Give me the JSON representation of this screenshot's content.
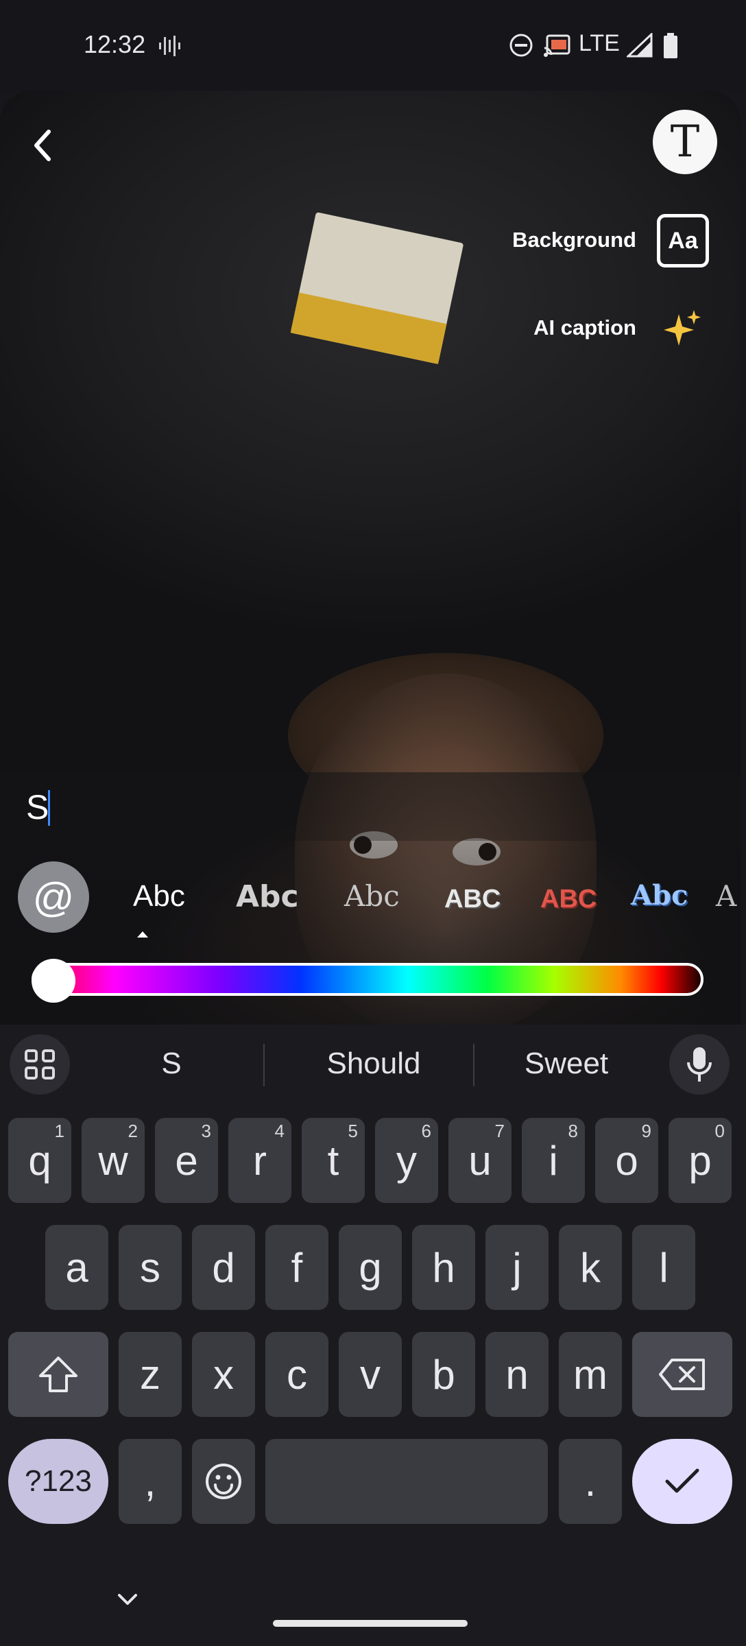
{
  "status_bar": {
    "time": "12:32",
    "icons": [
      "voice-waveform-icon",
      "do-not-disturb-icon",
      "cast-icon",
      "signal-icon",
      "battery-icon"
    ],
    "network": "LTE"
  },
  "editor": {
    "background_label": "Background",
    "background_button": "Aa",
    "ai_caption_label": "AI caption",
    "text_value": "S",
    "mention_symbol": "@",
    "font_options": [
      "Abc",
      "Abc",
      "Abc",
      "ABC",
      "ABC",
      "Abc",
      "A"
    ]
  },
  "keyboard": {
    "suggestions": [
      "S",
      "Should",
      "Sweet"
    ],
    "row1": [
      {
        "k": "q",
        "n": "1"
      },
      {
        "k": "w",
        "n": "2"
      },
      {
        "k": "e",
        "n": "3"
      },
      {
        "k": "r",
        "n": "4"
      },
      {
        "k": "t",
        "n": "5"
      },
      {
        "k": "y",
        "n": "6"
      },
      {
        "k": "u",
        "n": "7"
      },
      {
        "k": "i",
        "n": "8"
      },
      {
        "k": "o",
        "n": "9"
      },
      {
        "k": "p",
        "n": "0"
      }
    ],
    "row2": [
      "a",
      "s",
      "d",
      "f",
      "g",
      "h",
      "j",
      "k",
      "l"
    ],
    "row3": [
      "z",
      "x",
      "c",
      "v",
      "b",
      "n",
      "m"
    ],
    "symbols_key": "?123",
    "comma_key": ",",
    "period_key": "."
  },
  "colors": {
    "accent_caret": "#3e8bff",
    "enter_key": "#e3ddff",
    "symbols_key": "#c7c2e0"
  }
}
